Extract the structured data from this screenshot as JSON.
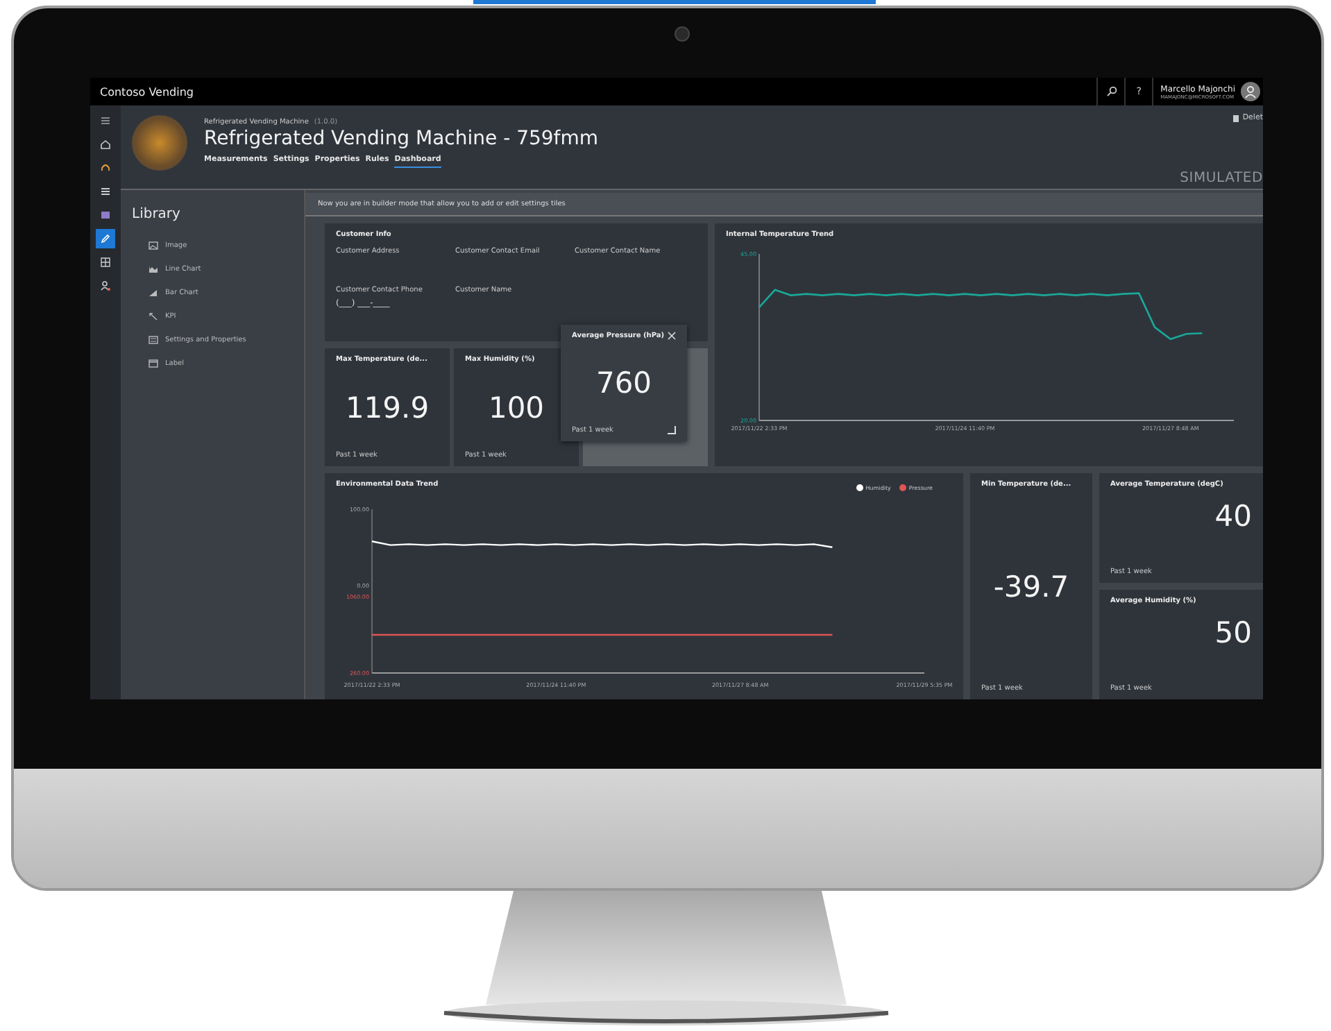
{
  "app_bar": {
    "title": "Contoso Vending",
    "help": "?",
    "user_name": "Marcello Majonchi",
    "user_email": "MAMAJONC@MICROSOFT.COM"
  },
  "nav_items": [
    {
      "selected": false
    },
    {
      "selected": false
    },
    {
      "selected": false
    },
    {
      "selected": false
    },
    {
      "selected": false
    },
    {
      "selected": true
    },
    {
      "selected": false
    },
    {
      "selected": false
    }
  ],
  "device": {
    "template": "Refrigerated Vending Machine",
    "version": "(1.0.0)",
    "title": "Refrigerated Vending Machine - 759fmm",
    "delete": "Delet",
    "mode": "SIMULATED",
    "tabs": [
      {
        "label": "Measurements",
        "selected": false
      },
      {
        "label": "Settings",
        "selected": false
      },
      {
        "label": "Properties",
        "selected": false
      },
      {
        "label": "Rules",
        "selected": false
      },
      {
        "label": "Dashboard",
        "selected": true
      }
    ]
  },
  "library": {
    "title": "Library",
    "items": [
      {
        "label": "Image"
      },
      {
        "label": "Line Chart"
      },
      {
        "label": "Bar Chart"
      },
      {
        "label": "KPI"
      },
      {
        "label": "Settings and Properties"
      },
      {
        "label": "Label"
      }
    ]
  },
  "banner": "Now you are in builder mode that allow you to add or edit settings tiles",
  "customer_info": {
    "title": "Customer Info",
    "fields": [
      {
        "label": "Customer Address"
      },
      {
        "label": "Customer Contact Email"
      },
      {
        "label": "Customer Contact Name"
      },
      {
        "label": "Customer Contact Phone",
        "value": "(___) ___-____"
      },
      {
        "label": "Customer Name"
      }
    ]
  },
  "kpi_tiles": [
    {
      "title": "Max Temperature (de...",
      "value": "119.9",
      "period": "Past 1 week"
    },
    {
      "title": "Max Humidity (%)",
      "value": "100",
      "period": "Past 1 week"
    }
  ],
  "dragged_tile": {
    "title": "Average Pressure (hPa)",
    "value": "760",
    "period": "Past 1 week"
  },
  "temperature_chart": {
    "chart_data": {
      "type": "line",
      "title": "Internal Temperature Trend",
      "ylim": [
        20,
        45
      ],
      "yticks": [
        {
          "value": 20,
          "label": "20.00"
        },
        {
          "value": 45,
          "label": "45.00"
        }
      ],
      "categories": [
        "2017/11/22 2:33 PM",
        null,
        null,
        null,
        null,
        null,
        null,
        null,
        null,
        null,
        null,
        null,
        null,
        "2017/11/24 11:40 PM",
        null,
        null,
        null,
        null,
        null,
        null,
        null,
        null,
        null,
        null,
        null,
        null,
        "2017/11/27 8:48 AM",
        null,
        null,
        null,
        null
      ],
      "series": [
        {
          "color": "#1aa89a",
          "values": [
            37,
            39.6,
            38.8,
            39,
            38.8,
            39,
            38.8,
            39,
            38.8,
            39,
            38.8,
            39,
            38.8,
            39,
            38.8,
            39,
            38.8,
            39,
            38.8,
            39,
            38.8,
            39,
            38.8,
            39,
            39.1,
            34,
            32.2,
            33,
            33.1,
            null,
            null
          ]
        }
      ]
    }
  },
  "environment_chart": {
    "chart_data": {
      "type": "line",
      "title": "Environmental Data Trend",
      "ylim": [
        -115,
        100
      ],
      "yticks": [
        {
          "value": 0,
          "label": "0.00"
        },
        {
          "value": 100,
          "label": "100.00"
        }
      ],
      "categories": [
        "2017/11/22 2:33 PM",
        null,
        null,
        null,
        null,
        null,
        null,
        null,
        null,
        null,
        "2017/11/24 11:40 PM",
        null,
        null,
        null,
        null,
        null,
        null,
        null,
        null,
        null,
        "2017/11/27 8:48 AM",
        null,
        null,
        null,
        null,
        null,
        null,
        null,
        null,
        null,
        "2017/11/29 5:35 PM"
      ],
      "series": [
        {
          "name": "Humidity",
          "color": "#ffffff",
          "values": [
            58,
            53,
            54,
            53,
            54,
            53,
            54,
            53,
            54,
            53,
            54,
            53,
            54,
            53,
            54,
            53,
            54,
            53,
            54,
            53,
            54,
            53,
            54,
            53,
            54,
            50,
            null,
            null,
            null,
            null,
            null
          ]
        }
      ]
    },
    "pressure_layer": {
      "chart_data": {
        "type": "line",
        "ylim": [
          260,
          1975
        ],
        "yticks": [
          {
            "value": 260,
            "label": "260.00"
          },
          {
            "value": 1060,
            "label": "1060.00"
          }
        ],
        "categories": [
          null,
          null,
          null,
          null,
          null,
          null,
          null,
          null,
          null,
          null,
          null,
          null,
          null,
          null,
          null,
          null,
          null,
          null,
          null,
          null,
          null,
          null,
          null,
          null,
          null,
          null,
          null,
          null,
          null,
          null,
          null
        ],
        "series": [
          {
            "name": "Pressure",
            "color": "#e05555",
            "values": [
              660,
              660,
              660,
              660,
              660,
              660,
              660,
              660,
              660,
              660,
              660,
              660,
              660,
              660,
              660,
              660,
              660,
              660,
              660,
              660,
              660,
              660,
              660,
              660,
              660,
              660,
              null,
              null,
              null,
              null,
              null
            ]
          }
        ]
      }
    }
  },
  "min_tile": {
    "title": "Min Temperature (de...",
    "value": "-39.7",
    "period": "Past 1 week"
  },
  "side_tiles": [
    {
      "title": "Average Temperature (degC)",
      "value": "40",
      "period": "Past 1 week"
    },
    {
      "title": "Average Humidity (%)",
      "value": "50",
      "period": "Past 1 week"
    }
  ]
}
